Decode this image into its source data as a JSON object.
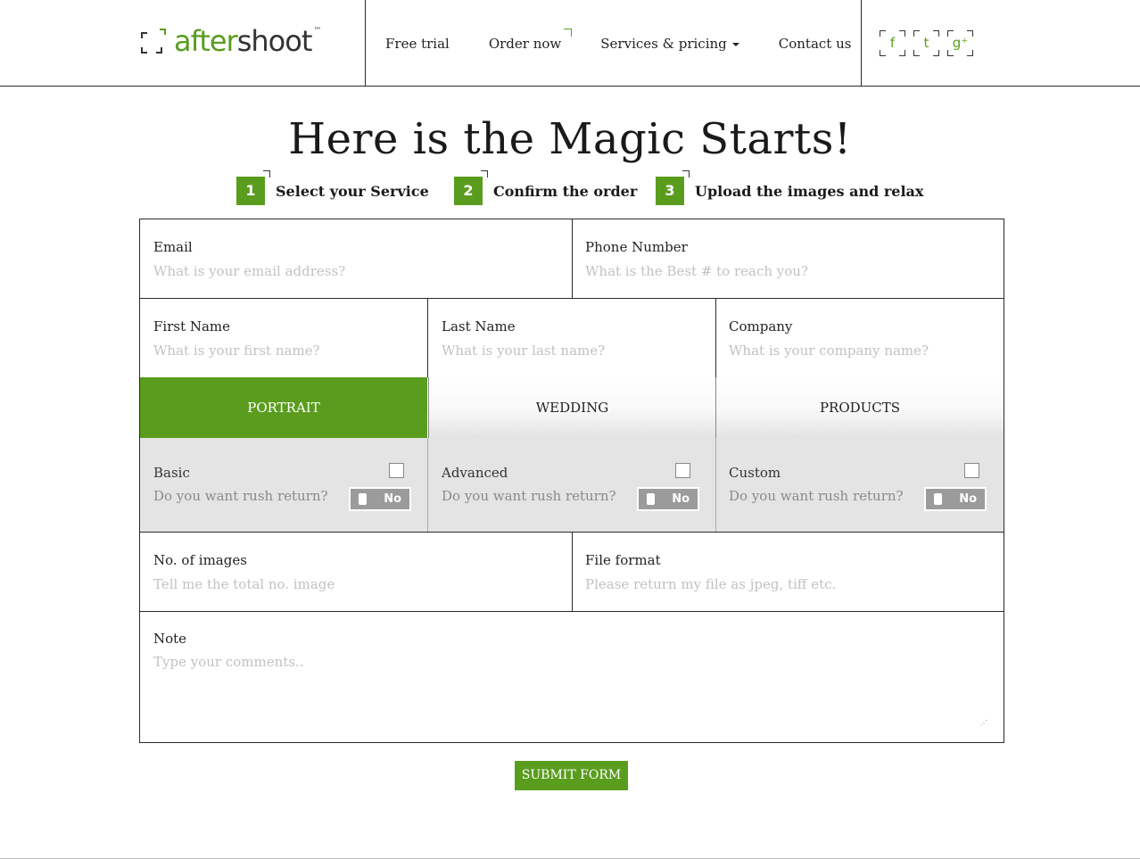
{
  "logo": {
    "after": "after",
    "shoot": "shoot",
    "tm": "™"
  },
  "nav": {
    "free_trial": "Free trial",
    "order_now": "Order now",
    "services": "Services & pricing",
    "contact": "Contact us"
  },
  "social": {
    "facebook": "f",
    "twitter": "t",
    "google": "g⁺"
  },
  "page_title": "Here is the Magic Starts!",
  "steps": [
    {
      "num": "1",
      "label": "Select your Service"
    },
    {
      "num": "2",
      "label": "Confirm the order"
    },
    {
      "num": "3",
      "label": "Upload the images and relax"
    }
  ],
  "form": {
    "email": {
      "label": "Email",
      "placeholder": "What is your email address?"
    },
    "phone": {
      "label": "Phone Number",
      "placeholder": "What is the Best # to reach you?"
    },
    "first_name": {
      "label": "First Name",
      "placeholder": "What is your first name?"
    },
    "last_name": {
      "label": "Last Name",
      "placeholder": "What is your last name?"
    },
    "company": {
      "label": "Company",
      "placeholder": "What is your company name?"
    },
    "tabs": [
      "PORTRAIT",
      "WEDDING",
      "PRODUCTS"
    ],
    "active_tab": "PORTRAIT",
    "options": [
      {
        "name": "Basic",
        "question": "Do you want rush return?",
        "toggle": "No"
      },
      {
        "name": "Advanced",
        "question": "Do you want rush return?",
        "toggle": "No"
      },
      {
        "name": "Custom",
        "question": "Do you want rush return?",
        "toggle": "No"
      }
    ],
    "num_images": {
      "label": "No. of images",
      "placeholder": "Tell me the total no. image"
    },
    "file_format": {
      "label": "File format",
      "placeholder": "Please return my file as jpeg, tiff etc."
    },
    "note": {
      "label": "Note",
      "placeholder": "Type your comments.."
    },
    "submit": "SUBMIT FORM"
  },
  "colors": {
    "accent": "#5a9d1e",
    "options_bg": "#e4e4e4",
    "toggle_bg": "#9b9b9b"
  }
}
